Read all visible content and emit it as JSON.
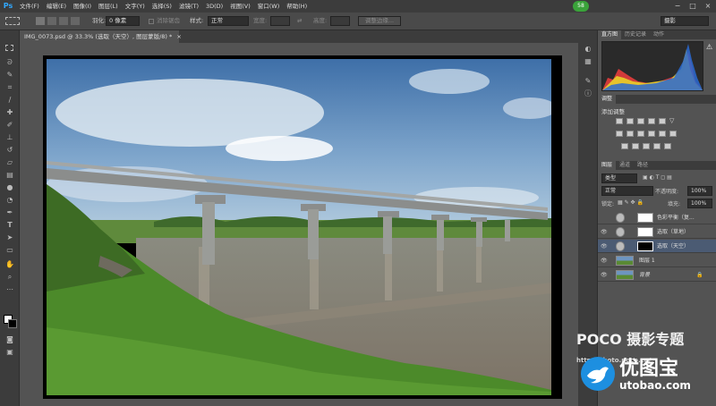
{
  "app": {
    "logo": "Ps"
  },
  "menu": [
    "文件(F)",
    "编辑(E)",
    "图像(I)",
    "图层(L)",
    "文字(Y)",
    "选择(S)",
    "滤镜(T)",
    "3D(D)",
    "视图(V)",
    "窗口(W)",
    "帮助(H)"
  ],
  "badge": "58",
  "window_buttons": [
    "−",
    "□",
    "×"
  ],
  "options": {
    "feather_label": "羽化:",
    "feather_value": "0 像素",
    "antialias_label": "消除锯齿",
    "style_label": "样式:",
    "style_value": "正常",
    "width_label": "宽度:",
    "height_label": "高度:",
    "refine_button": "调整边缘...",
    "workspace_value": "摄影"
  },
  "document": {
    "tab_title": "IMG_0073.psd @ 33.3% (选取（天空）, 图层蒙版/8) *",
    "close": "×"
  },
  "tools": [
    "rect-marquee-icon",
    "lasso-icon",
    "quick-select-icon",
    "crop-icon",
    "eyedropper-icon",
    "healing-icon",
    "brush-icon",
    "clone-stamp-icon",
    "history-brush-icon",
    "eraser-icon",
    "gradient-icon",
    "blur-icon",
    "dodge-icon",
    "pen-icon",
    "type-icon",
    "path-select-icon",
    "shape-icon",
    "hand-icon",
    "zoom-icon"
  ],
  "panels": {
    "top_tabs": [
      "直方图",
      "历史记录",
      "动作"
    ],
    "adjust_tab": "调整",
    "adjust_title": "添加调整",
    "layers_tabs": [
      "图层",
      "通道",
      "路径"
    ],
    "kind_label": "类型",
    "blend_mode": "正常",
    "opacity_label": "不透明度:",
    "opacity_value": "100%",
    "lock_label": "锁定:",
    "fill_label": "填充:",
    "fill_value": "100%",
    "layers": [
      {
        "name": "色彩平衡（复...",
        "visible": false,
        "selected": false
      },
      {
        "name": "选取（草地）",
        "visible": true,
        "selected": false
      },
      {
        "name": "选取（天空）",
        "visible": true,
        "selected": true
      },
      {
        "name": "图层 1",
        "visible": true,
        "selected": false
      },
      {
        "name": "背景",
        "visible": true,
        "selected": false
      }
    ]
  },
  "watermarks": {
    "poco": "POCO 摄影专题",
    "poco_url": "http://photo.poco.cn/",
    "youtubao": "优图宝",
    "youtubao_url": "utobao.com"
  }
}
